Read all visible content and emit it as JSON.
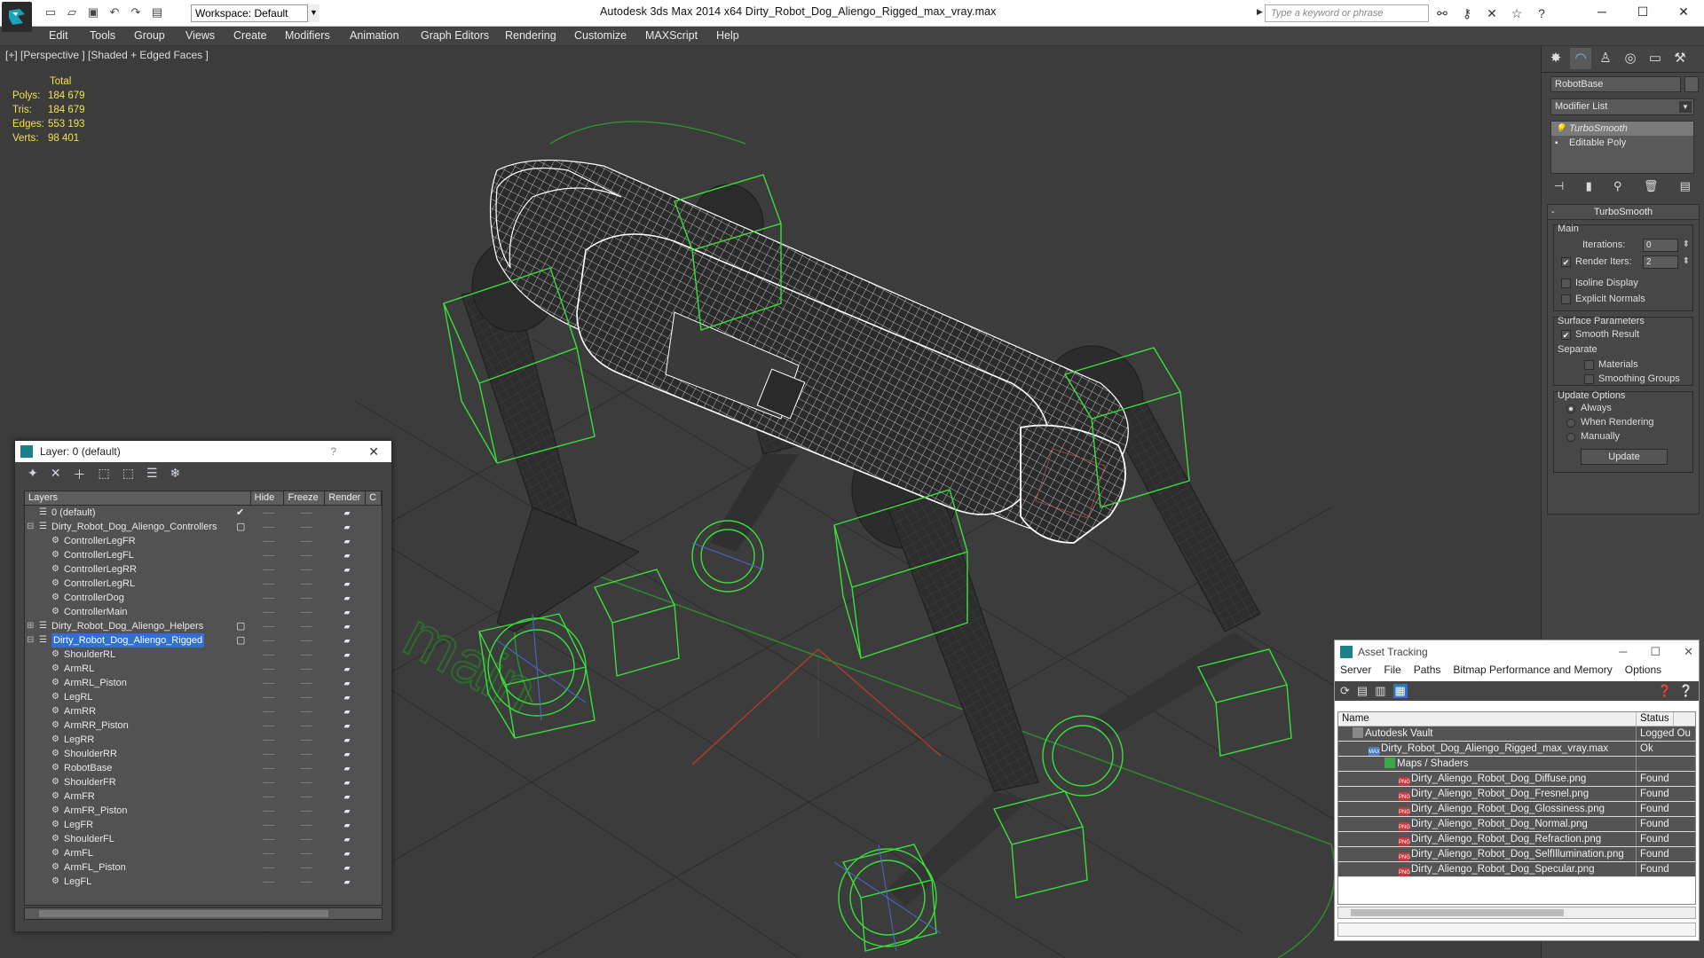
{
  "app": {
    "title": "Autodesk 3ds Max  2014 x64       Dirty_Robot_Dog_Aliengo_Rigged_max_vray.max",
    "workspace": "Workspace: Default",
    "search_placeholder": "Type a keyword or phrase"
  },
  "menu": [
    "Edit",
    "Tools",
    "Group",
    "Views",
    "Create",
    "Modifiers",
    "Animation",
    "Graph Editors",
    "Rendering",
    "Customize",
    "MAXScript",
    "Help"
  ],
  "viewport": {
    "label": "[+] [Perspective ] [Shaded + Edged Faces ]",
    "stats": {
      "header": "Total",
      "rows": [
        {
          "k": "Polys:",
          "v": "184 679"
        },
        {
          "k": "Tris:",
          "v": "184 679"
        },
        {
          "k": "Edges:",
          "v": "553 193"
        },
        {
          "k": "Verts:",
          "v": "98 401"
        }
      ]
    },
    "ground_text": "main"
  },
  "command_panel": {
    "object_name": "RobotBase",
    "modifier_list": "Modifier List",
    "stack": [
      "TurboSmooth",
      "Editable Poly"
    ],
    "turbosmooth": {
      "title": "TurboSmooth",
      "main": "Main",
      "iterations_label": "Iterations:",
      "iterations": "0",
      "render_iters_label": "Render Iters:",
      "render_iters": "2",
      "isoline": "Isoline Display",
      "explicit": "Explicit Normals",
      "surface": "Surface Parameters",
      "smooth_result": "Smooth Result",
      "separate": "Separate",
      "materials": "Materials",
      "smoothing_groups": "Smoothing Groups",
      "update_options": "Update Options",
      "always": "Always",
      "when_rendering": "When Rendering",
      "manually": "Manually",
      "update": "Update"
    }
  },
  "layer_window": {
    "title": "Layer: 0 (default)",
    "help": "?",
    "columns": [
      "Layers",
      "Hide",
      "Freeze",
      "Render",
      "C"
    ],
    "rows": [
      {
        "name": "0 (default)",
        "level": 0,
        "layer": true,
        "check": "✔"
      },
      {
        "name": "Dirty_Robot_Dog_Aliengo_Controllers",
        "level": 0,
        "layer": true,
        "expander": "⊟",
        "check": "▢"
      },
      {
        "name": "ControllerLegFR",
        "level": 1
      },
      {
        "name": "ControllerLegFL",
        "level": 1
      },
      {
        "name": "ControllerLegRR",
        "level": 1
      },
      {
        "name": "ControllerLegRL",
        "level": 1
      },
      {
        "name": "ControllerDog",
        "level": 1
      },
      {
        "name": "ControllerMain",
        "level": 1
      },
      {
        "name": "Dirty_Robot_Dog_Aliengo_Helpers",
        "level": 0,
        "layer": true,
        "expander": "⊞",
        "check": "▢"
      },
      {
        "name": "Dirty_Robot_Dog_Aliengo_Rigged",
        "level": 0,
        "layer": true,
        "expander": "⊟",
        "check": "▢",
        "selected": true
      },
      {
        "name": "ShoulderRL",
        "level": 1
      },
      {
        "name": "ArmRL",
        "level": 1
      },
      {
        "name": "ArmRL_Piston",
        "level": 1
      },
      {
        "name": "LegRL",
        "level": 1
      },
      {
        "name": "ArmRR",
        "level": 1
      },
      {
        "name": "ArmRR_Piston",
        "level": 1
      },
      {
        "name": "LegRR",
        "level": 1
      },
      {
        "name": "ShoulderRR",
        "level": 1
      },
      {
        "name": "RobotBase",
        "level": 1
      },
      {
        "name": "ShoulderFR",
        "level": 1
      },
      {
        "name": "ArmFR",
        "level": 1
      },
      {
        "name": "ArmFR_Piston",
        "level": 1
      },
      {
        "name": "LegFR",
        "level": 1
      },
      {
        "name": "ShoulderFL",
        "level": 1
      },
      {
        "name": "ArmFL",
        "level": 1
      },
      {
        "name": "ArmFL_Piston",
        "level": 1
      },
      {
        "name": "LegFL",
        "level": 1
      }
    ]
  },
  "asset_tracking": {
    "title": "Asset Tracking",
    "menu": [
      "Server",
      "File",
      "Paths",
      "Bitmap Performance and Memory",
      "Options"
    ],
    "columns": [
      "Name",
      "Status"
    ],
    "rows": [
      {
        "name": "Autodesk Vault",
        "status": "Logged Ou",
        "indent": 16,
        "icon": "vault"
      },
      {
        "name": "Dirty_Robot_Dog_Aliengo_Rigged_max_vray.max",
        "status": "Ok",
        "indent": 34,
        "icon": "max"
      },
      {
        "name": "Maps / Shaders",
        "status": "",
        "indent": 52,
        "icon": "maps"
      },
      {
        "name": "Dirty_Aliengo_Robot_Dog_Diffuse.png",
        "status": "Found",
        "indent": 68,
        "icon": "png"
      },
      {
        "name": "Dirty_Aliengo_Robot_Dog_Fresnel.png",
        "status": "Found",
        "indent": 68,
        "icon": "png"
      },
      {
        "name": "Dirty_Aliengo_Robot_Dog_Glossiness.png",
        "status": "Found",
        "indent": 68,
        "icon": "png"
      },
      {
        "name": "Dirty_Aliengo_Robot_Dog_Normal.png",
        "status": "Found",
        "indent": 68,
        "icon": "png"
      },
      {
        "name": "Dirty_Aliengo_Robot_Dog_Refraction.png",
        "status": "Found",
        "indent": 68,
        "icon": "png"
      },
      {
        "name": "Dirty_Aliengo_Robot_Dog_SelfIllumination.png",
        "status": "Found",
        "indent": 68,
        "icon": "png"
      },
      {
        "name": "Dirty_Aliengo_Robot_Dog_Specular.png",
        "status": "Found",
        "indent": 68,
        "icon": "png"
      }
    ]
  }
}
